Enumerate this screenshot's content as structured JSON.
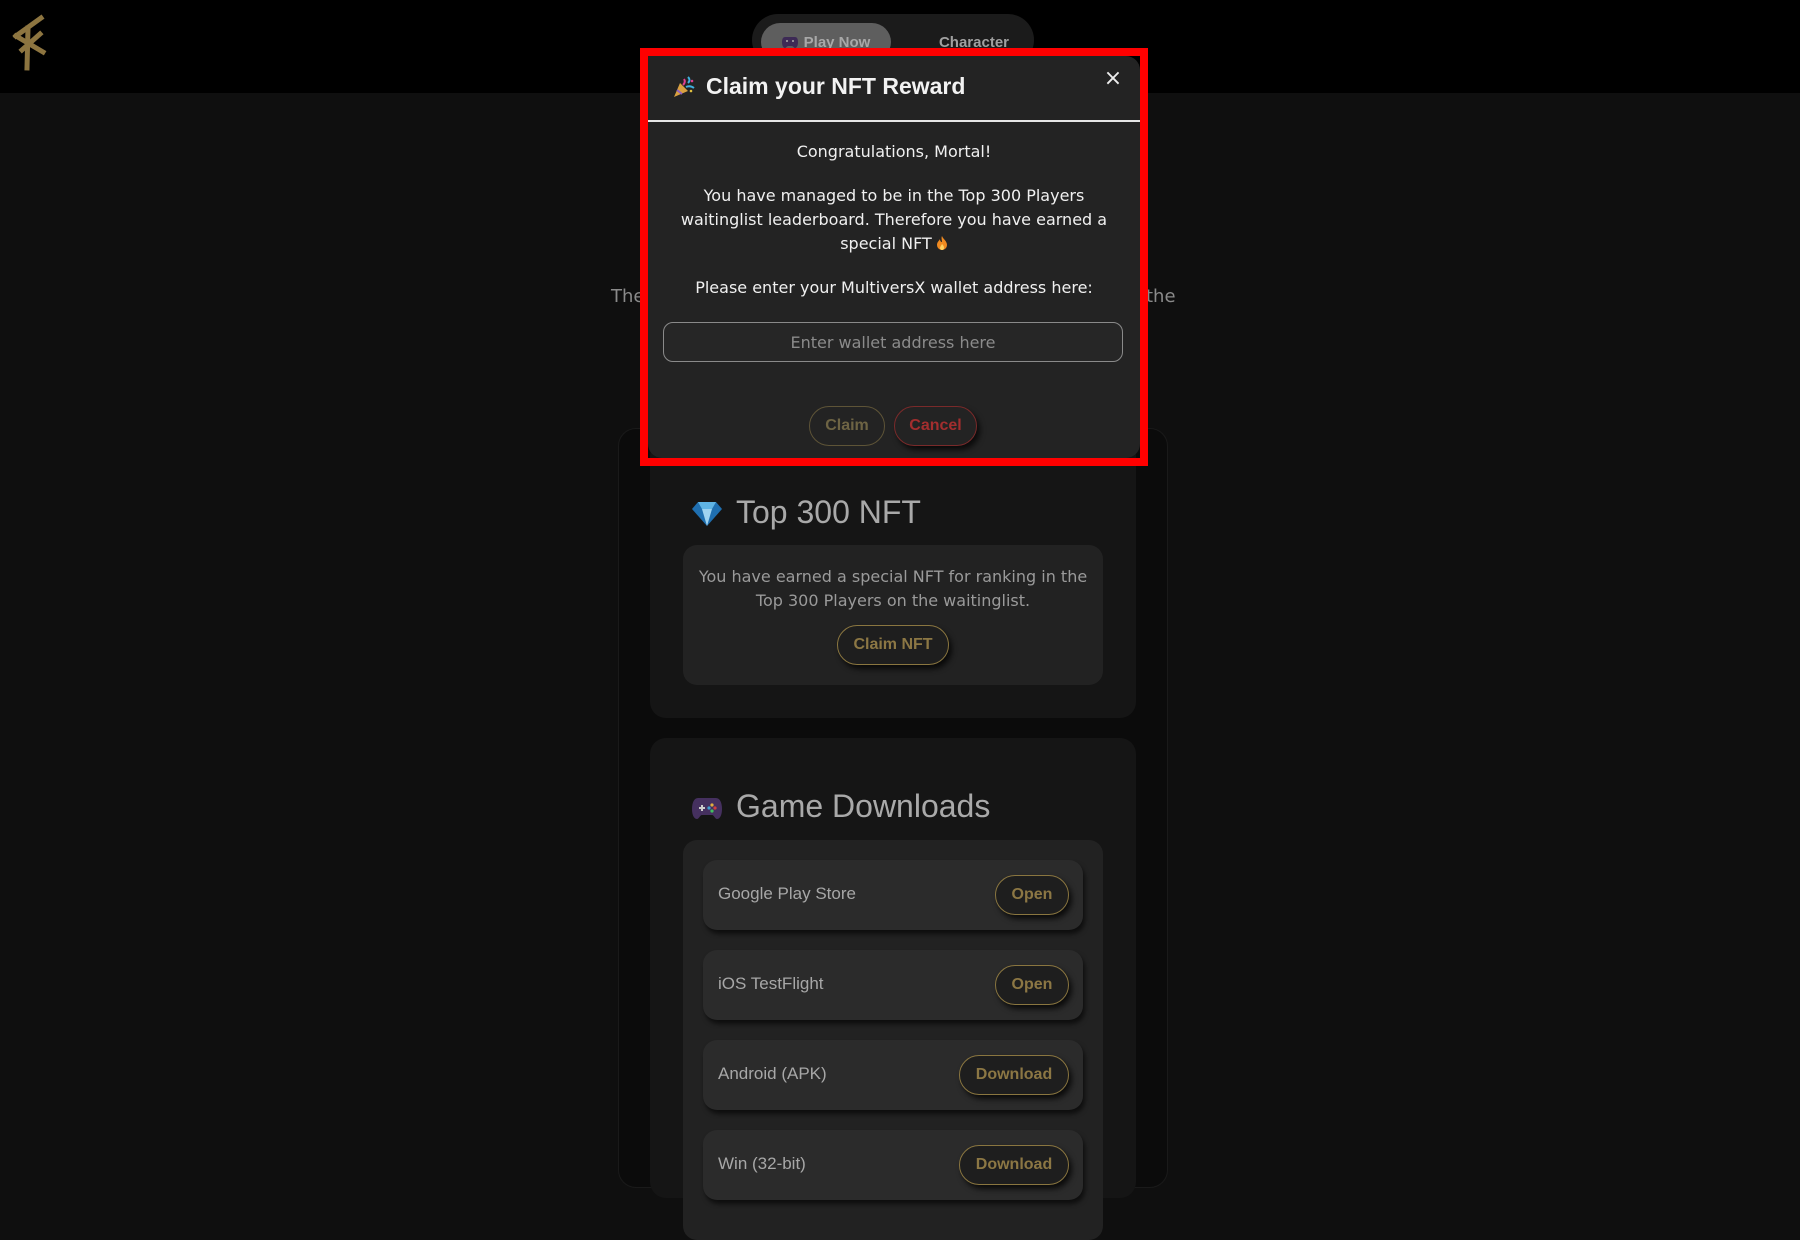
{
  "header": {
    "logo": "rune-logo-icon",
    "tabs": [
      {
        "label": "Play Now",
        "icon": "gamepad-icon",
        "active": true
      },
      {
        "label": "Character",
        "active": false
      }
    ]
  },
  "background_text": {
    "left_fragment": "The",
    "right_fragment": "the"
  },
  "modal": {
    "title": "Claim your NFT Reward",
    "title_icon": "party-popper-icon",
    "close_label": "×",
    "greeting": "Congratulations, Mortal!",
    "message": "You have managed to be in the Top 300 Players waitinglist leaderboard. Therefore you have earned a special NFT",
    "message_icon": "fire-icon",
    "prompt": "Please enter your MultiversX wallet address here:",
    "input": {
      "value": "",
      "placeholder": "Enter wallet address here"
    },
    "claim_label": "Claim",
    "cancel_label": "Cancel"
  },
  "nft_card": {
    "title": "Top 300 NFT",
    "icon": "gem-icon",
    "description": "You have earned a special NFT for ranking in the Top 300 Players on the waitinglist.",
    "button_label": "Claim NFT"
  },
  "downloads_card": {
    "title": "Game Downloads",
    "icon": "gamepad-icon",
    "items": [
      {
        "label": "Google Play Store",
        "action": "Open"
      },
      {
        "label": "iOS TestFlight",
        "action": "Open"
      },
      {
        "label": "Android (APK)",
        "action": "Download"
      },
      {
        "label": "Win (32-bit)",
        "action": "Download"
      }
    ]
  },
  "colors": {
    "accent_gold": "#8c7744",
    "cancel_red": "#a32e2e",
    "highlight_frame": "#ff0000"
  }
}
